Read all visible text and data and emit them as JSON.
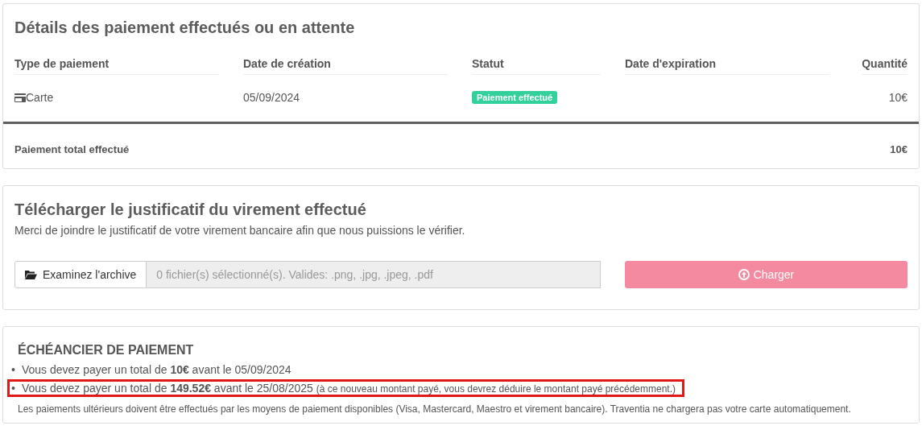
{
  "payments": {
    "title": "Détails des paiement effectués ou en attente",
    "columns": [
      {
        "label": "Type de paiement"
      },
      {
        "label": "Date de création"
      },
      {
        "label": "Statut"
      },
      {
        "label": "Date d'expiration"
      },
      {
        "label": "Quantité"
      }
    ],
    "rows": [
      {
        "type": "Carte",
        "created": "05/09/2024",
        "status": "Paiement effectué",
        "color": "#32d09a",
        "expiration": "",
        "amount": "10€"
      }
    ],
    "total_label": "Paiement total effectué",
    "total": "10€"
  },
  "upload": {
    "title": "Télécharger le justificatif du virement effectué",
    "description": "Merci de joindre le justificatif de votre virement bancaire afin que nous puissions le vérifier.",
    "browse_button": "Examinez l'archive",
    "placeholder": "0 fichier(s) sélectionné(s). Valides: .png, .jpg, .jpeg, .pdf",
    "submit_button": "Charger",
    "submit_disabled": true
  },
  "schedule": {
    "title": "ÉCHÉANCIER DE PAIEMENT",
    "items": [
      {
        "marker": "•",
        "text": "Vous devez payer un total de **10€** avant le 05/09/2024",
        "highlighted": false
      },
      {
        "marker": "•",
        "text": "Vous devez payer un total de **149.52€** avant le 25/08/2025",
        "note": "(à ce nouveau montant payé, vous devrez déduire le montant payé précédemment.)",
        "highlighted": true
      }
    ],
    "footnote": "Les paiements ultérieurs doivent être effectués par les moyens de paiement disponibles (Visa, Mastercard, Maestro et virement bancaire). Traventia ne chargera pas votre carte automatiquement."
  }
}
